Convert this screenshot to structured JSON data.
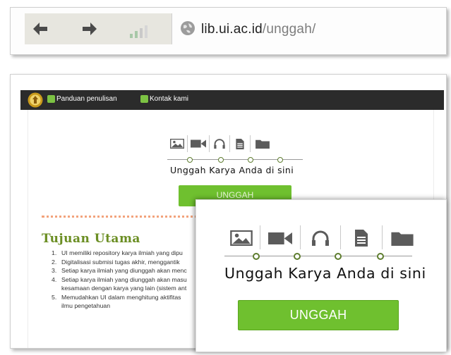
{
  "browser": {
    "url_host": "lib.ui.ac.id",
    "url_path": "/unggah/",
    "back_icon": "back-arrow-icon",
    "forward_icon": "forward-arrow-icon",
    "signal_icon": "signal-bars-icon",
    "site_icon": "globe-icon"
  },
  "topnav": {
    "logo_icon": "ui-logo-icon",
    "links": [
      {
        "label": "Panduan penulisan",
        "icon": "guide-icon"
      },
      {
        "label": "Kontak kami",
        "icon": "contact-icon"
      }
    ]
  },
  "upload": {
    "media_icons": [
      "image-icon",
      "video-icon",
      "audio-icon",
      "document-icon",
      "folder-icon"
    ],
    "caption": "Unggah Karya Anda di sini",
    "button_label": "UNGGAH"
  },
  "goals": {
    "title": "Tujuan Utama",
    "items": [
      {
        "num": "1.",
        "text": "UI memiliki repository karya ilmiah yang dipu"
      },
      {
        "num": "2.",
        "text": "Digitalisasi submisi tugas akhir, menggantik"
      },
      {
        "num": "3.",
        "text": "Setiap karya ilmiah yang diunggah akan menc"
      },
      {
        "num": "4.",
        "text": "Setiap karya ilmiah yang diunggah akan masu"
      },
      {
        "num": "",
        "text": "kesamaan dengan karya yang lain (sistem ant"
      },
      {
        "num": "5.",
        "text": "Memudahkan UI dalam menghitung aktifitas "
      },
      {
        "num": "",
        "text": "ilmu pengetahuan"
      }
    ]
  },
  "colors": {
    "accent_green": "#6fc02f",
    "title_green": "#6b8e23",
    "icon_gray": "#5b5b5b",
    "dotted_orange": "#f2a37c",
    "nav_dark": "#2b2b2b"
  }
}
